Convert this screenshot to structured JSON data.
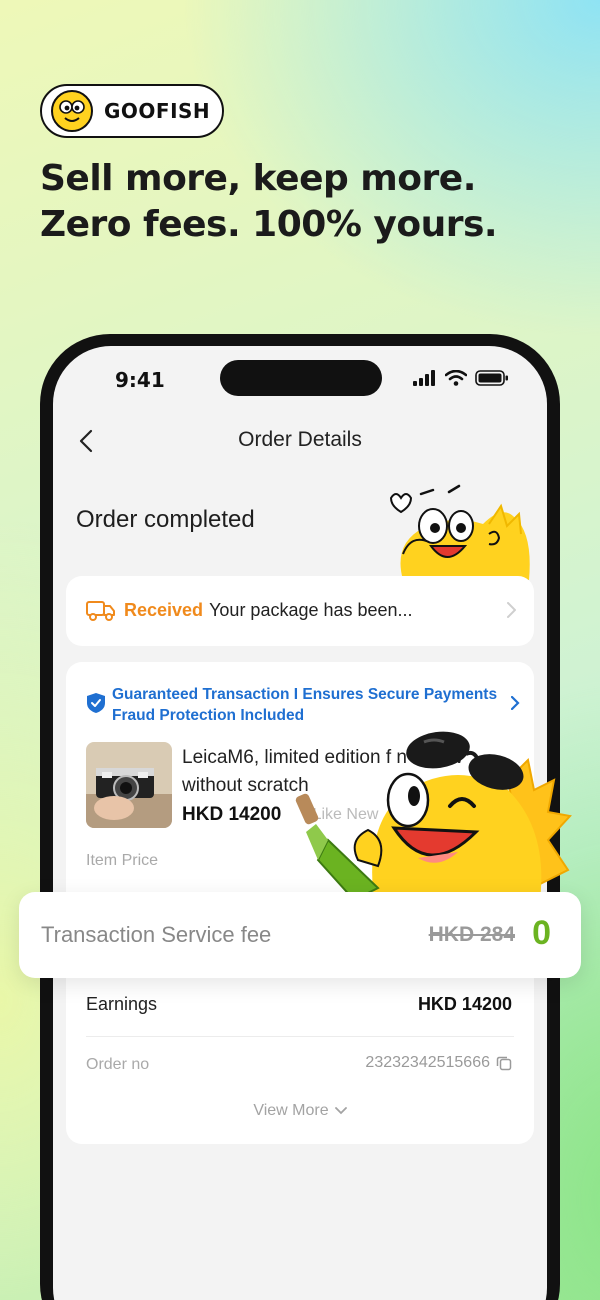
{
  "brand": {
    "name": "GOOFISH",
    "logo_icon": "goofish-fish-mascot-icon"
  },
  "headline": {
    "line1": "Sell more, keep more.",
    "line2": "Zero fees. 100% yours."
  },
  "status_bar": {
    "time": "9:41",
    "icons": [
      "cellular-signal-icon",
      "wifi-icon",
      "battery-icon"
    ]
  },
  "nav": {
    "back_icon": "chevron-left-icon",
    "title": "Order Details"
  },
  "order": {
    "status": "Order completed"
  },
  "received": {
    "icon": "truck-icon",
    "label": "Received",
    "text": "Your package has been..."
  },
  "guarantee": {
    "icon": "shield-check-icon",
    "text": "Guaranteed Transaction I Ensures Secure Payments Fraud Protection Included"
  },
  "item": {
    "image_icon": "camera-photo-thumbnail",
    "title": "LeicaM6, limited edition f      n d new without scratch",
    "price": "HKD 14200",
    "tag": "| Like New",
    "price_label": "Item Price"
  },
  "fee": {
    "label": "Transaction Service fee",
    "old_value": "HKD 284",
    "new_value": "0"
  },
  "earnings": {
    "label": "Earnings",
    "value": "HKD 14200"
  },
  "order_no": {
    "label": "Order no",
    "value": "23232342515666",
    "copy_icon": "copy-icon"
  },
  "view_more": {
    "label": "View More",
    "icon": "chevron-down-icon"
  },
  "colors": {
    "accent_orange": "#f08a1c",
    "link_blue": "#1f6fd1",
    "fee_green": "#6bb321",
    "mascot_yellow": "#ffd21f"
  }
}
